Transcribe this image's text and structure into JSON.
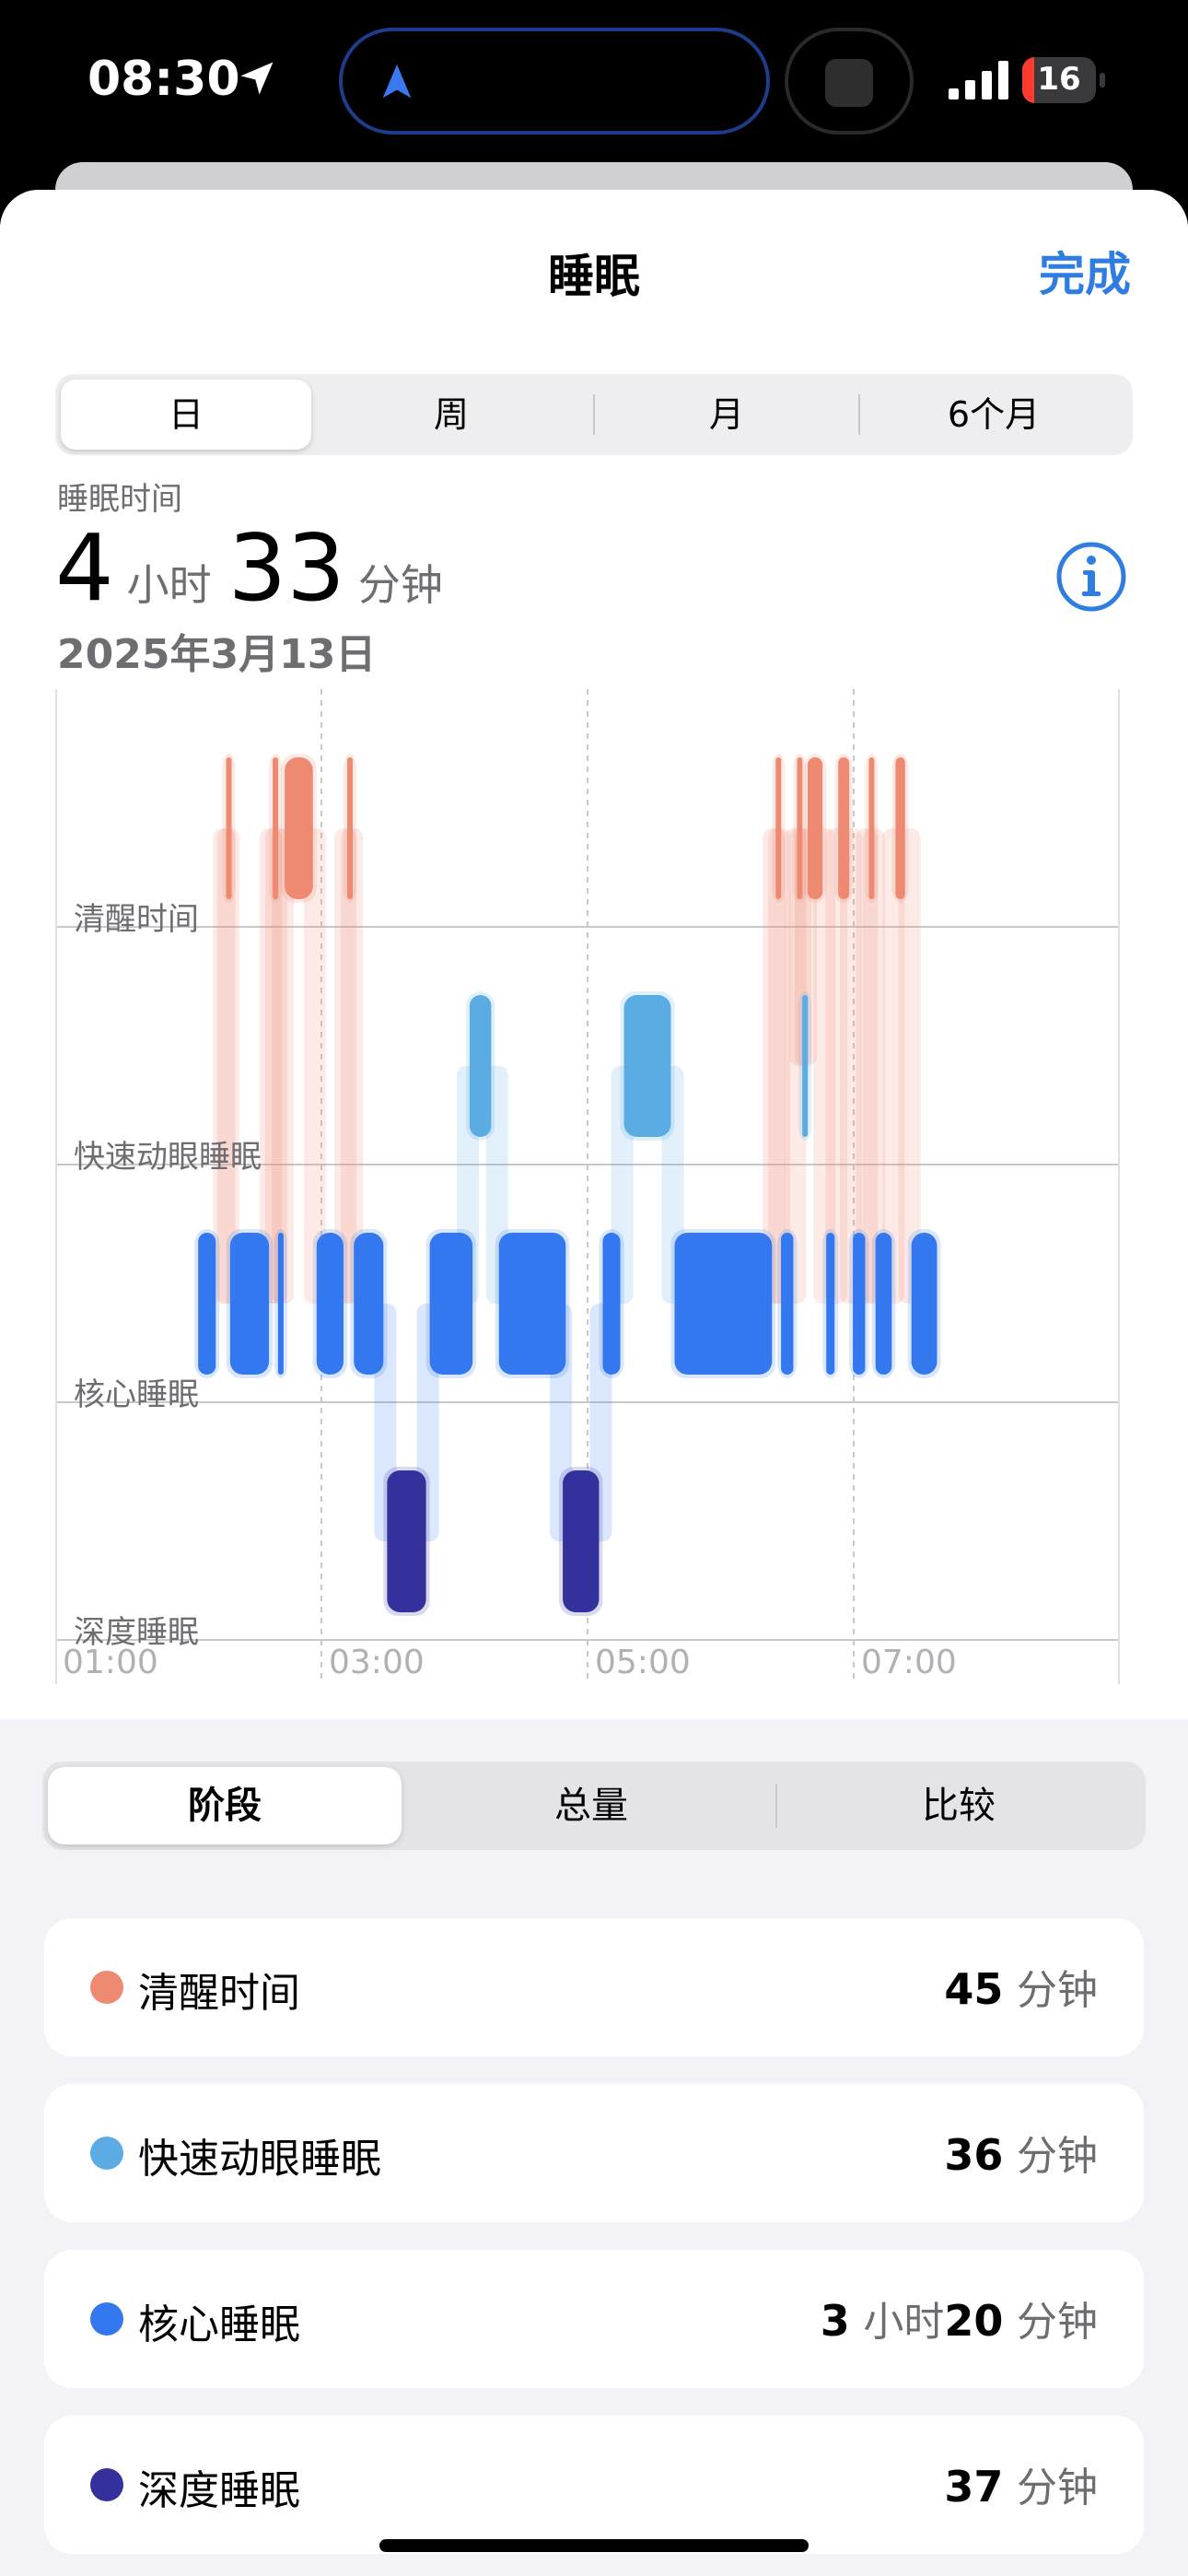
{
  "status_bar": {
    "time": "08:30",
    "battery": "16",
    "battery_fraction": 0.16
  },
  "nav": {
    "title": "睡眠",
    "done": "完成"
  },
  "range_tabs": [
    "日",
    "周",
    "月",
    "6个月"
  ],
  "range_selected": "日",
  "summary": {
    "label": "睡眠时间",
    "hours": "4",
    "hours_unit": "小时",
    "minutes": "33",
    "minutes_unit": "分钟",
    "date": "2025年3月13日"
  },
  "chart_data": {
    "type": "hypnogram",
    "stages": [
      "清醒时间",
      "快速动眼睡眠",
      "核心睡眠",
      "深度睡眠"
    ],
    "stage_colors": {
      "清醒时间": "#ef8a72",
      "快速动眼睡眠": "#5aace3",
      "核心睡眠": "#3478f0",
      "深度睡眠": "#34319c"
    },
    "x_ticks": [
      "01:00",
      "03:00",
      "05:00",
      "07:00"
    ],
    "x_range_hours": [
      1.0,
      9.0
    ],
    "segments": [
      {
        "stage": "核心睡眠",
        "start": 2.06,
        "end": 2.22
      },
      {
        "stage": "清醒时间",
        "start": 2.27,
        "end": 2.29
      },
      {
        "stage": "核心睡眠",
        "start": 2.3,
        "end": 2.62
      },
      {
        "stage": "清醒时间",
        "start": 2.62,
        "end": 2.66
      },
      {
        "stage": "核心睡眠",
        "start": 2.66,
        "end": 2.7
      },
      {
        "stage": "清醒时间",
        "start": 2.71,
        "end": 2.95
      },
      {
        "stage": "核心睡眠",
        "start": 2.95,
        "end": 3.18
      },
      {
        "stage": "清醒时间",
        "start": 3.18,
        "end": 3.23
      },
      {
        "stage": "核心睡眠",
        "start": 3.23,
        "end": 3.48
      },
      {
        "stage": "深度睡眠",
        "start": 3.48,
        "end": 3.8
      },
      {
        "stage": "核心睡眠",
        "start": 3.8,
        "end": 4.15
      },
      {
        "stage": "快速动眼睡眠",
        "start": 4.1,
        "end": 4.29
      },
      {
        "stage": "核心睡眠",
        "start": 4.32,
        "end": 4.85
      },
      {
        "stage": "深度睡眠",
        "start": 4.8,
        "end": 5.1
      },
      {
        "stage": "核心睡眠",
        "start": 5.1,
        "end": 5.26
      },
      {
        "stage": "快速动眼睡眠",
        "start": 5.26,
        "end": 5.64
      },
      {
        "stage": "核心睡眠",
        "start": 5.64,
        "end": 6.4
      },
      {
        "stage": "清醒时间",
        "start": 6.4,
        "end": 6.44
      },
      {
        "stage": "核心睡眠",
        "start": 6.44,
        "end": 6.56
      },
      {
        "stage": "清醒时间",
        "start": 6.56,
        "end": 6.6
      },
      {
        "stage": "快速动眼睡眠",
        "start": 6.6,
        "end": 6.64
      },
      {
        "stage": "清醒时间",
        "start": 6.64,
        "end": 6.78
      },
      {
        "stage": "核心睡眠",
        "start": 6.78,
        "end": 6.87
      },
      {
        "stage": "清醒时间",
        "start": 6.87,
        "end": 6.98
      },
      {
        "stage": "核心睡眠",
        "start": 6.98,
        "end": 7.1
      },
      {
        "stage": "清醒时间",
        "start": 7.1,
        "end": 7.15
      },
      {
        "stage": "核心睡眠",
        "start": 7.15,
        "end": 7.3
      },
      {
        "stage": "清醒时间",
        "start": 7.3,
        "end": 7.4
      },
      {
        "stage": "核心睡眠",
        "start": 7.42,
        "end": 7.64
      }
    ]
  },
  "view_tabs": [
    "阶段",
    "总量",
    "比较"
  ],
  "view_selected": "阶段",
  "stage_totals": [
    {
      "label": "清醒时间",
      "color": "#ef8a72",
      "h": "",
      "h_unit": "",
      "m": "45",
      "m_unit": "分钟"
    },
    {
      "label": "快速动眼睡眠",
      "color": "#5aace3",
      "h": "",
      "h_unit": "",
      "m": "36",
      "m_unit": "分钟"
    },
    {
      "label": "核心睡眠",
      "color": "#3478f0",
      "h": "3",
      "h_unit": "小时",
      "m": "20",
      "m_unit": "分钟"
    },
    {
      "label": "深度睡眠",
      "color": "#34319c",
      "h": "",
      "h_unit": "",
      "m": "37",
      "m_unit": "分钟"
    }
  ]
}
